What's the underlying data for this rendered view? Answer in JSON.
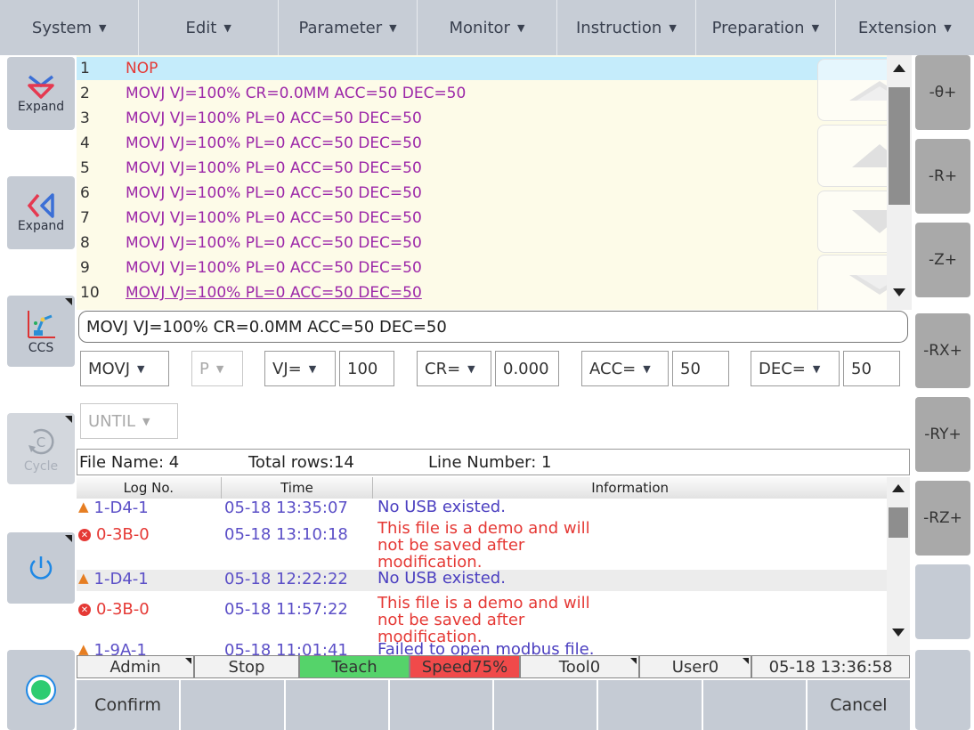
{
  "menu": [
    {
      "label": "System",
      "caret": "▼"
    },
    {
      "label": "Edit",
      "caret": "▼"
    },
    {
      "label": "Parameter",
      "caret": "▼"
    },
    {
      "label": "Monitor",
      "caret": "▼"
    },
    {
      "label": "Instruction",
      "caret": "▼"
    },
    {
      "label": "Preparation",
      "caret": "▼"
    },
    {
      "label": "Extension",
      "caret": "▼"
    }
  ],
  "left_buttons": {
    "expand_down": "Expand",
    "expand_left": "Expand",
    "ccs": "CCS",
    "cycle": "Cycle"
  },
  "right_buttons": [
    "-θ+",
    "-R+",
    "-Z+",
    "-RX+",
    "-RY+",
    "-RZ+"
  ],
  "program": {
    "lines": [
      {
        "num": "1",
        "text": "NOP"
      },
      {
        "num": "2",
        "text": "MOVJ VJ=100% CR=0.0MM ACC=50 DEC=50"
      },
      {
        "num": "3",
        "text": "MOVJ VJ=100% PL=0 ACC=50 DEC=50"
      },
      {
        "num": "4",
        "text": "MOVJ VJ=100% PL=0 ACC=50 DEC=50"
      },
      {
        "num": "5",
        "text": "MOVJ VJ=100% PL=0 ACC=50 DEC=50"
      },
      {
        "num": "6",
        "text": "MOVJ VJ=100% PL=0 ACC=50 DEC=50"
      },
      {
        "num": "7",
        "text": "MOVJ VJ=100% PL=0 ACC=50 DEC=50"
      },
      {
        "num": "8",
        "text": "MOVJ VJ=100% PL=0 ACC=50 DEC=50"
      },
      {
        "num": "9",
        "text": "MOVJ VJ=100% PL=0 ACC=50 DEC=50"
      },
      {
        "num": "10",
        "text": "MOVJ VJ=100% PL=0 ACC=50 DEC=50"
      }
    ]
  },
  "edit_line": "MOVJ VJ=100% CR=0.0MM ACC=50 DEC=50",
  "params": {
    "cmd": "MOVJ",
    "p": "P",
    "vj_label": "VJ=",
    "vj_value": "100",
    "cr_label": "CR=",
    "cr_value": "0.000",
    "acc_label": "ACC=",
    "acc_value": "50",
    "dec_label": "DEC=",
    "dec_value": "50",
    "until": "UNTIL"
  },
  "info": {
    "file_name": "File Name: 4",
    "total_rows": "Total rows:14",
    "line_number": "Line Number: 1"
  },
  "log": {
    "headers": [
      "Log No.",
      "Time",
      "Information"
    ],
    "rows": [
      {
        "type": "warn",
        "no": "1-D4-1",
        "time": "05-18 13:35:07",
        "info": "No USB existed."
      },
      {
        "type": "error",
        "no": "0-3B-0",
        "time": "05-18 13:10:18",
        "info": "This file is a demo and will not be saved after modification."
      },
      {
        "type": "warn",
        "no": "1-D4-1",
        "time": "05-18 12:22:22",
        "info": "No USB existed."
      },
      {
        "type": "error",
        "no": "0-3B-0",
        "time": "05-18 11:57:22",
        "info": "This file is a demo and will not be saved after modification."
      },
      {
        "type": "warn",
        "no": "1-9A-1",
        "time": "05-18 11:01:41",
        "info": "Failed to open modbus file."
      }
    ]
  },
  "status": {
    "user": "Admin",
    "state": "Stop",
    "mode": "Teach",
    "speed": "Speed75%",
    "tool": "Tool0",
    "coord": "User0",
    "datetime": "05-18 13:36:58"
  },
  "bottom": {
    "confirm": "Confirm",
    "cancel": "Cancel"
  },
  "colors": {
    "teach": "#55d36a",
    "speed": "#f04a4a",
    "selected_row": "#c5ecfb",
    "program_bg": "#fdfbe8"
  }
}
